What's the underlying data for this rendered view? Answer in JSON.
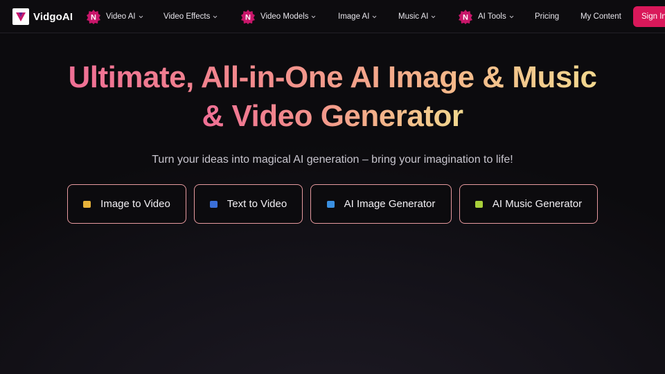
{
  "brand": {
    "name": "VidgoAI"
  },
  "nav": {
    "items": [
      {
        "label": "Video AI",
        "icon": "new-badge-icon",
        "dropdown": true
      },
      {
        "label": "Video Effects",
        "icon": "",
        "dropdown": true
      },
      {
        "label": "Video Models",
        "icon": "new-badge-icon",
        "dropdown": true
      },
      {
        "label": "Image AI",
        "icon": "",
        "dropdown": true
      },
      {
        "label": "Music AI",
        "icon": "",
        "dropdown": true
      },
      {
        "label": "AI Tools",
        "icon": "new-badge-icon",
        "dropdown": true
      },
      {
        "label": "Pricing",
        "icon": "",
        "dropdown": false
      },
      {
        "label": "My Content",
        "icon": "",
        "dropdown": false
      }
    ],
    "signin_label": "Sign In"
  },
  "hero": {
    "title_line1": "Ultimate, All-in-One AI Image & Music",
    "title_line2": "& Video Generator",
    "subtitle": "Turn your ideas into magical AI generation – bring your imagination to life!"
  },
  "actions": [
    {
      "label": "Image to Video",
      "icon": "picture-emoji-icon",
      "icon_color": "#e8b33a"
    },
    {
      "label": "Text to Video",
      "icon": "film-emoji-icon",
      "icon_color": "#3b6fd8"
    },
    {
      "label": "AI Image Generator",
      "icon": "image-frame-emoji-icon",
      "icon_color": "#3a8fe0"
    },
    {
      "label": "AI Music Generator",
      "icon": "music-emoji-icon",
      "icon_color": "#a8cf3a"
    }
  ],
  "colors": {
    "accent": "#d9185a",
    "badge": "#c8166a",
    "gradient": [
      "#ef6f95",
      "#f4b58a",
      "#f2d88f"
    ],
    "button_border": "#e79a9f"
  }
}
